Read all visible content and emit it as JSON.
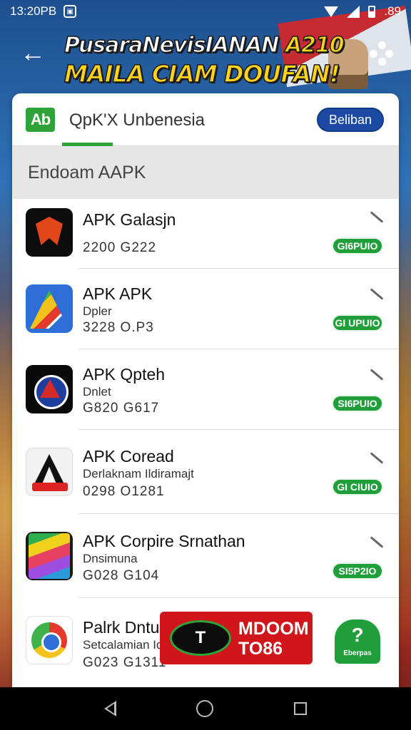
{
  "status_bar": {
    "time": "13:20PB",
    "battery_text": ".89"
  },
  "header": {
    "banner_line1_main": "PusaraNevisIANAN ",
    "banner_line1_accent": "A210",
    "banner_line2": "MAILA CIAM DOUFAN!"
  },
  "store": {
    "logo_text": "Ab",
    "title": "QpK'X Unbenesia",
    "action_button": "Beliban",
    "section_title": "Endoam AAPK"
  },
  "apps": [
    {
      "name": "APK Galasjn",
      "sub": "",
      "meta": "2200  G222",
      "badge": "GI6PUIO"
    },
    {
      "name": "APK APK",
      "sub": "Dpler",
      "meta": "3228  O.P3",
      "badge": "GI UPUIO"
    },
    {
      "name": "APK Qpteh",
      "sub": "Dnlet",
      "meta": "G820  G617",
      "badge": "SI6PUIO"
    },
    {
      "name": "APK Coread",
      "sub": "Derlaknam Ildiramajt",
      "meta": "0298  O1281",
      "badge": "GI CIUIO"
    },
    {
      "name": "APK Corpire Srnathan",
      "sub": "Dnsimuna",
      "meta": "G028  G104",
      "badge": "SI5P2IO"
    },
    {
      "name": "Palrk Dntur",
      "sub": "Setcalamian Idiomlt",
      "meta": "G023  G1311",
      "badge": ""
    }
  ],
  "promo": {
    "logo_text": "T",
    "line1": "MDOOM",
    "line2": "TO86"
  },
  "help_button": {
    "symbol": "?",
    "label": "Eberpas"
  },
  "colors": {
    "brand_green": "#1f9e3a",
    "button_blue": "#1c4aa3",
    "promo_red": "#d0151b"
  }
}
